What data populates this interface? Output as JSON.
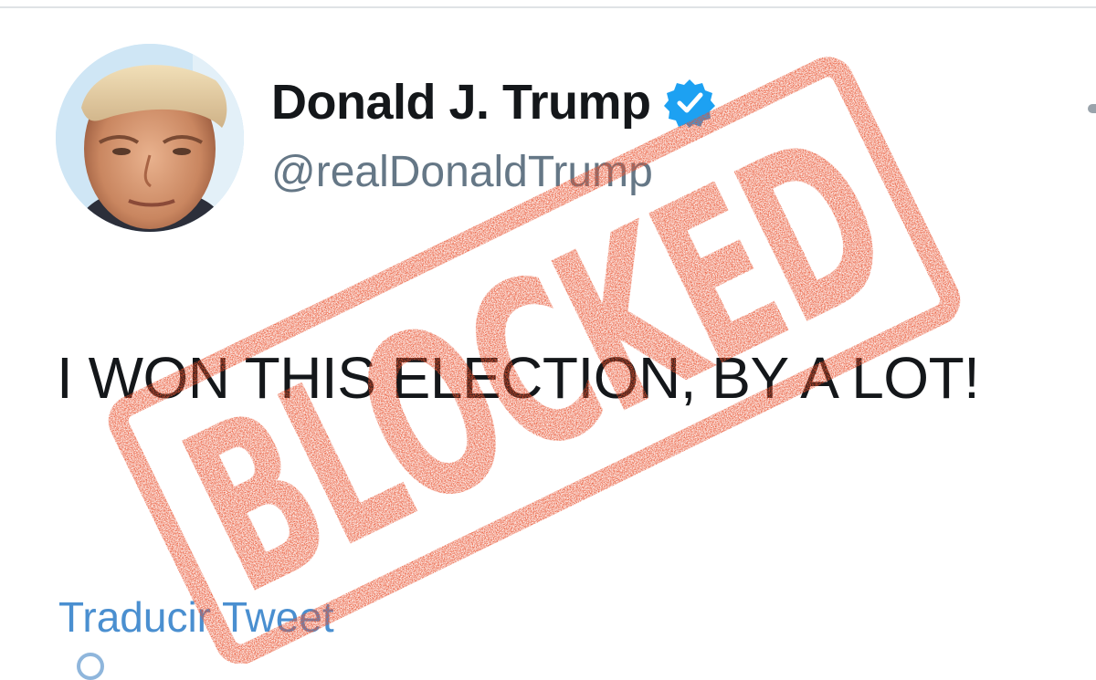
{
  "tweet": {
    "display_name": "Donald J. Trump",
    "handle": "@realDonaldTrump",
    "verified_icon": "verified-badge-icon",
    "text": "I WON THIS ELECTION, BY A LOT!",
    "translate_label": "Traducir Tweet"
  },
  "overlay": {
    "stamp_text": "BLOCKED",
    "stamp_color": "#e8512e"
  },
  "colors": {
    "handle": "#657786",
    "link": "#4a8fd0",
    "verified": "#1da1f2",
    "text": "#14171a"
  }
}
